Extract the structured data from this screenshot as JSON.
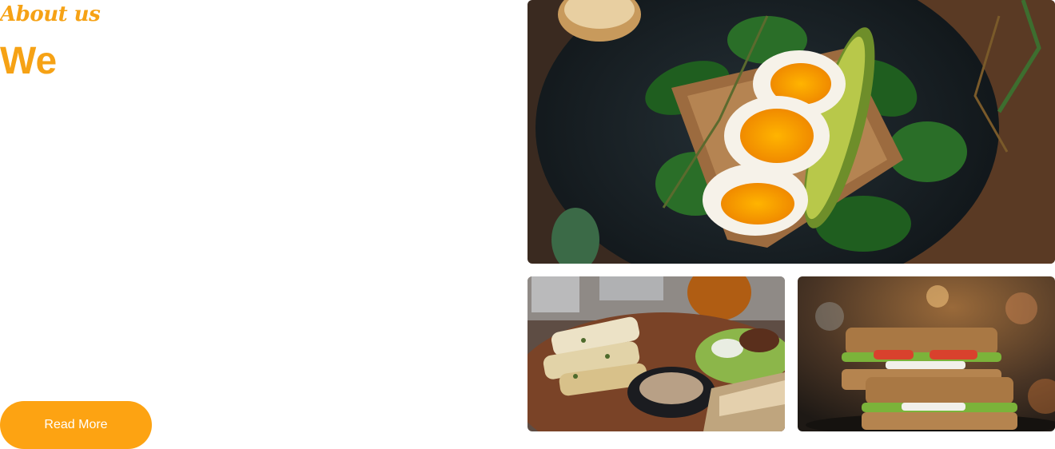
{
  "about": {
    "eyebrow": "About us",
    "headline": "We",
    "read_more_label": "Read More"
  },
  "gallery": [
    {
      "subject": "egg-avocado-toast-photo"
    },
    {
      "subject": "grilled-platter-photo"
    },
    {
      "subject": "sandwich-stack-photo"
    }
  ],
  "colors": {
    "accent": "#f6a215",
    "button": "#fda312",
    "button_text": "#ffffff"
  }
}
